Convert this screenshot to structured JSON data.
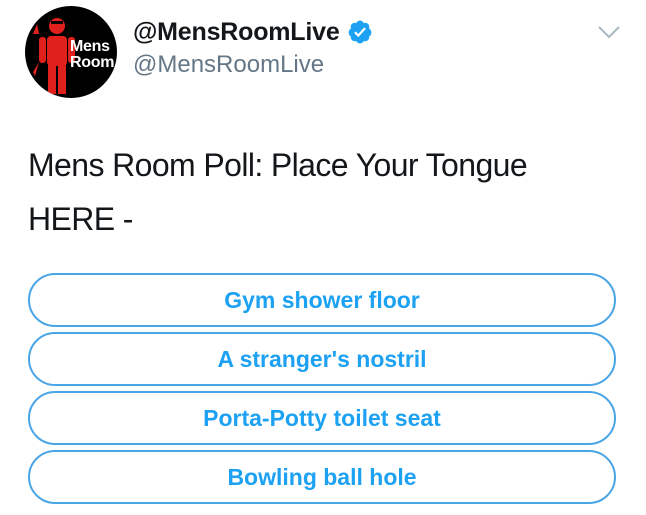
{
  "author": {
    "avatar_text_line1": "Mens",
    "avatar_text_line2": "Room",
    "display_name": "@MensRoomLive",
    "handle": "@MensRoomLive",
    "verified": true,
    "avatar_icon": "red-man-figure-icon"
  },
  "tweet": {
    "text": "Mens Room Poll: Place Your Tongue HERE -"
  },
  "poll": {
    "options": [
      "Gym shower floor",
      "A stranger's nostril",
      "Porta-Potty toilet seat",
      "Bowling ball hole"
    ]
  },
  "icons": {
    "verified": "verified-badge-icon",
    "menu": "chevron-down-icon"
  },
  "colors": {
    "accent": "#1da1f2",
    "poll_border": "#4aa5e6",
    "handle": "#657786",
    "avatar_bg": "#000000",
    "avatar_figure": "#e0201c"
  }
}
